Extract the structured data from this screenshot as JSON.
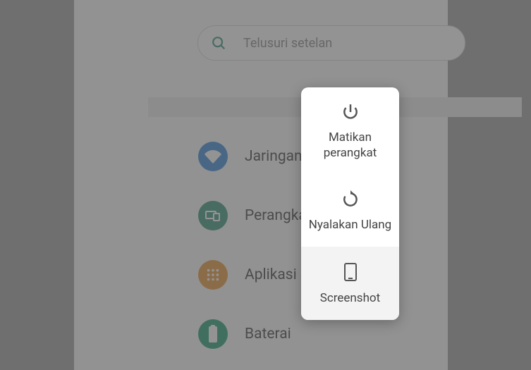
{
  "search": {
    "placeholder": "Telusuri setelan"
  },
  "settings": [
    {
      "label": "Jaringan & internet",
      "icon": "wifi",
      "color": "blue"
    },
    {
      "label": "Perangkat terhubung",
      "icon": "devices",
      "color": "teal"
    },
    {
      "label": "Aplikasi & notifikasi",
      "icon": "apps",
      "color": "orange"
    },
    {
      "label": "Baterai",
      "icon": "battery",
      "color": "green"
    }
  ],
  "power_menu": [
    {
      "label": "Matikan perangkat",
      "icon": "power"
    },
    {
      "label": "Nyalakan Ulang",
      "icon": "restart"
    },
    {
      "label": "Screenshot",
      "icon": "screenshot"
    }
  ]
}
